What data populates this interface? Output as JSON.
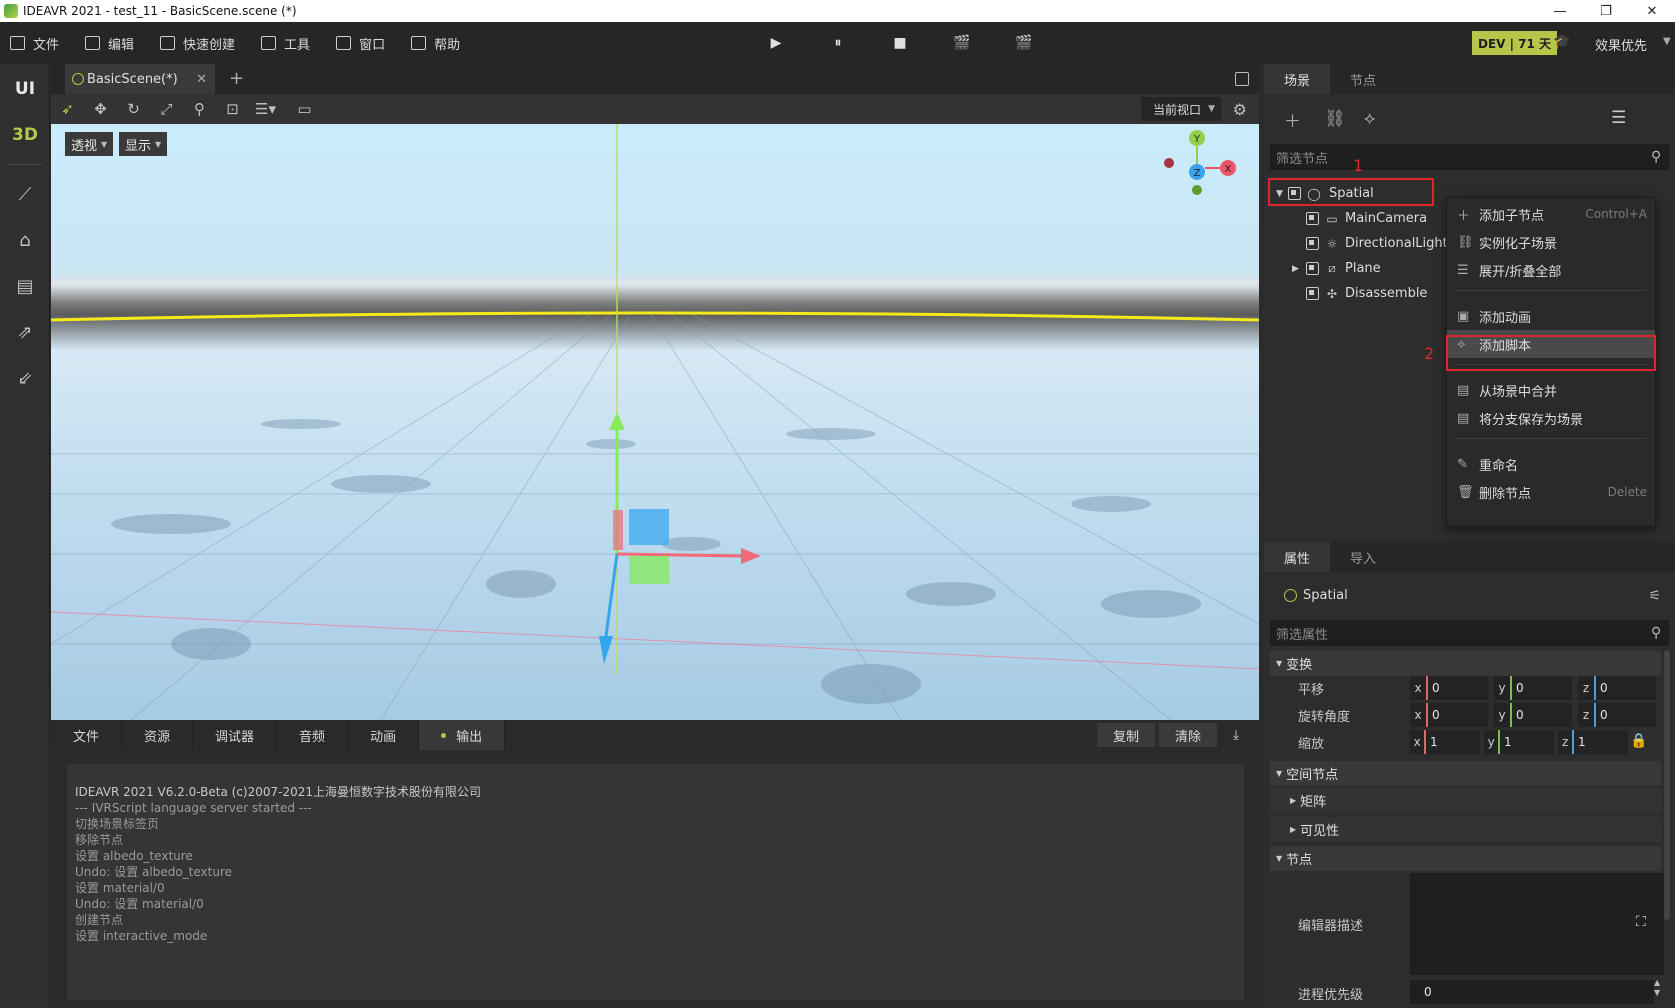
{
  "window": {
    "title": "IDEAVR 2021 - test_11 - BasicScene.scene (*)",
    "min": "—",
    "restore": "❐",
    "close": "✕"
  },
  "menu": {
    "items": [
      "文件",
      "编辑",
      "快速创建",
      "工具",
      "窗口",
      "帮助"
    ],
    "play": "▶",
    "pause": "⏸",
    "stop": "■",
    "movie1": "🎬",
    "movie2": "🎬",
    "dev_badge": "DEV | 71 天",
    "quality": "效果优先"
  },
  "leftbar": {
    "ui_mode": "UI",
    "three_d_mode": "3D"
  },
  "scene_tabs": {
    "active_tab": "BasicScene(*)",
    "close": "✕",
    "add": "+"
  },
  "viewport": {
    "perspective_btn": "透视",
    "display_btn": "显示",
    "view_select": "当前视口",
    "gizmo_y": "Y",
    "gizmo_x": "X",
    "gizmo_z": "Z"
  },
  "scene_panel": {
    "tabs": [
      "场景",
      "节点"
    ],
    "filter_placeholder": "筛选节点",
    "nodes": [
      {
        "name": "Spatial"
      },
      {
        "name": "MainCamera"
      },
      {
        "name": "DirectionalLight"
      },
      {
        "name": "Plane"
      },
      {
        "name": "Disassemble"
      }
    ]
  },
  "context_menu": {
    "add_child": "添加子节点",
    "add_child_shortcut": "Control+A",
    "instance_scene": "实例化子场景",
    "expand_collapse": "展开/折叠全部",
    "add_animation": "添加动画",
    "add_script": "添加脚本",
    "merge_from_scene": "从场景中合并",
    "save_branch": "将分支保存为场景",
    "rename": "重命名",
    "delete_node": "删除节点",
    "delete_shortcut": "Delete"
  },
  "annotations": {
    "label1": "1",
    "label2": "2"
  },
  "bottom": {
    "tabs": [
      "文件",
      "资源",
      "调试器",
      "音频",
      "动画",
      "输出"
    ],
    "copy": "复制",
    "clear": "清除",
    "output_lines": [
      "IDEAVR 2021 V6.2.0-Beta (c)2007-2021上海曼恒数字技术股份有限公司",
      "--- IVRScript language server started ---",
      "切换场景标签页",
      "移除节点",
      "设置 albedo_texture",
      "Undo: 设置 albedo_texture",
      "设置 material/0",
      "Undo: 设置 material/0",
      "创建节点",
      "设置 interactive_mode"
    ]
  },
  "inspector": {
    "tabs": [
      "属性",
      "导入"
    ],
    "node_name": "Spatial",
    "filter_placeholder": "筛选属性",
    "transform_section": "变换",
    "translation_label": "平移",
    "rotation_label": "旋转角度",
    "scale_label": "缩放",
    "translation": {
      "x": "0",
      "y": "0",
      "z": "0"
    },
    "rotation": {
      "x": "0",
      "y": "0",
      "z": "0"
    },
    "scale": {
      "x": "1",
      "y": "1",
      "z": "1"
    },
    "spatial_section": "空间节点",
    "matrix_section": "矩阵",
    "visibility_section": "可见性",
    "node_section": "节点",
    "editor_desc_label": "编辑器描述",
    "priority_label": "进程优先级",
    "priority_value": "0"
  },
  "colors": {
    "accent": "#b7c54a",
    "annotation_red": "#e0242b"
  }
}
